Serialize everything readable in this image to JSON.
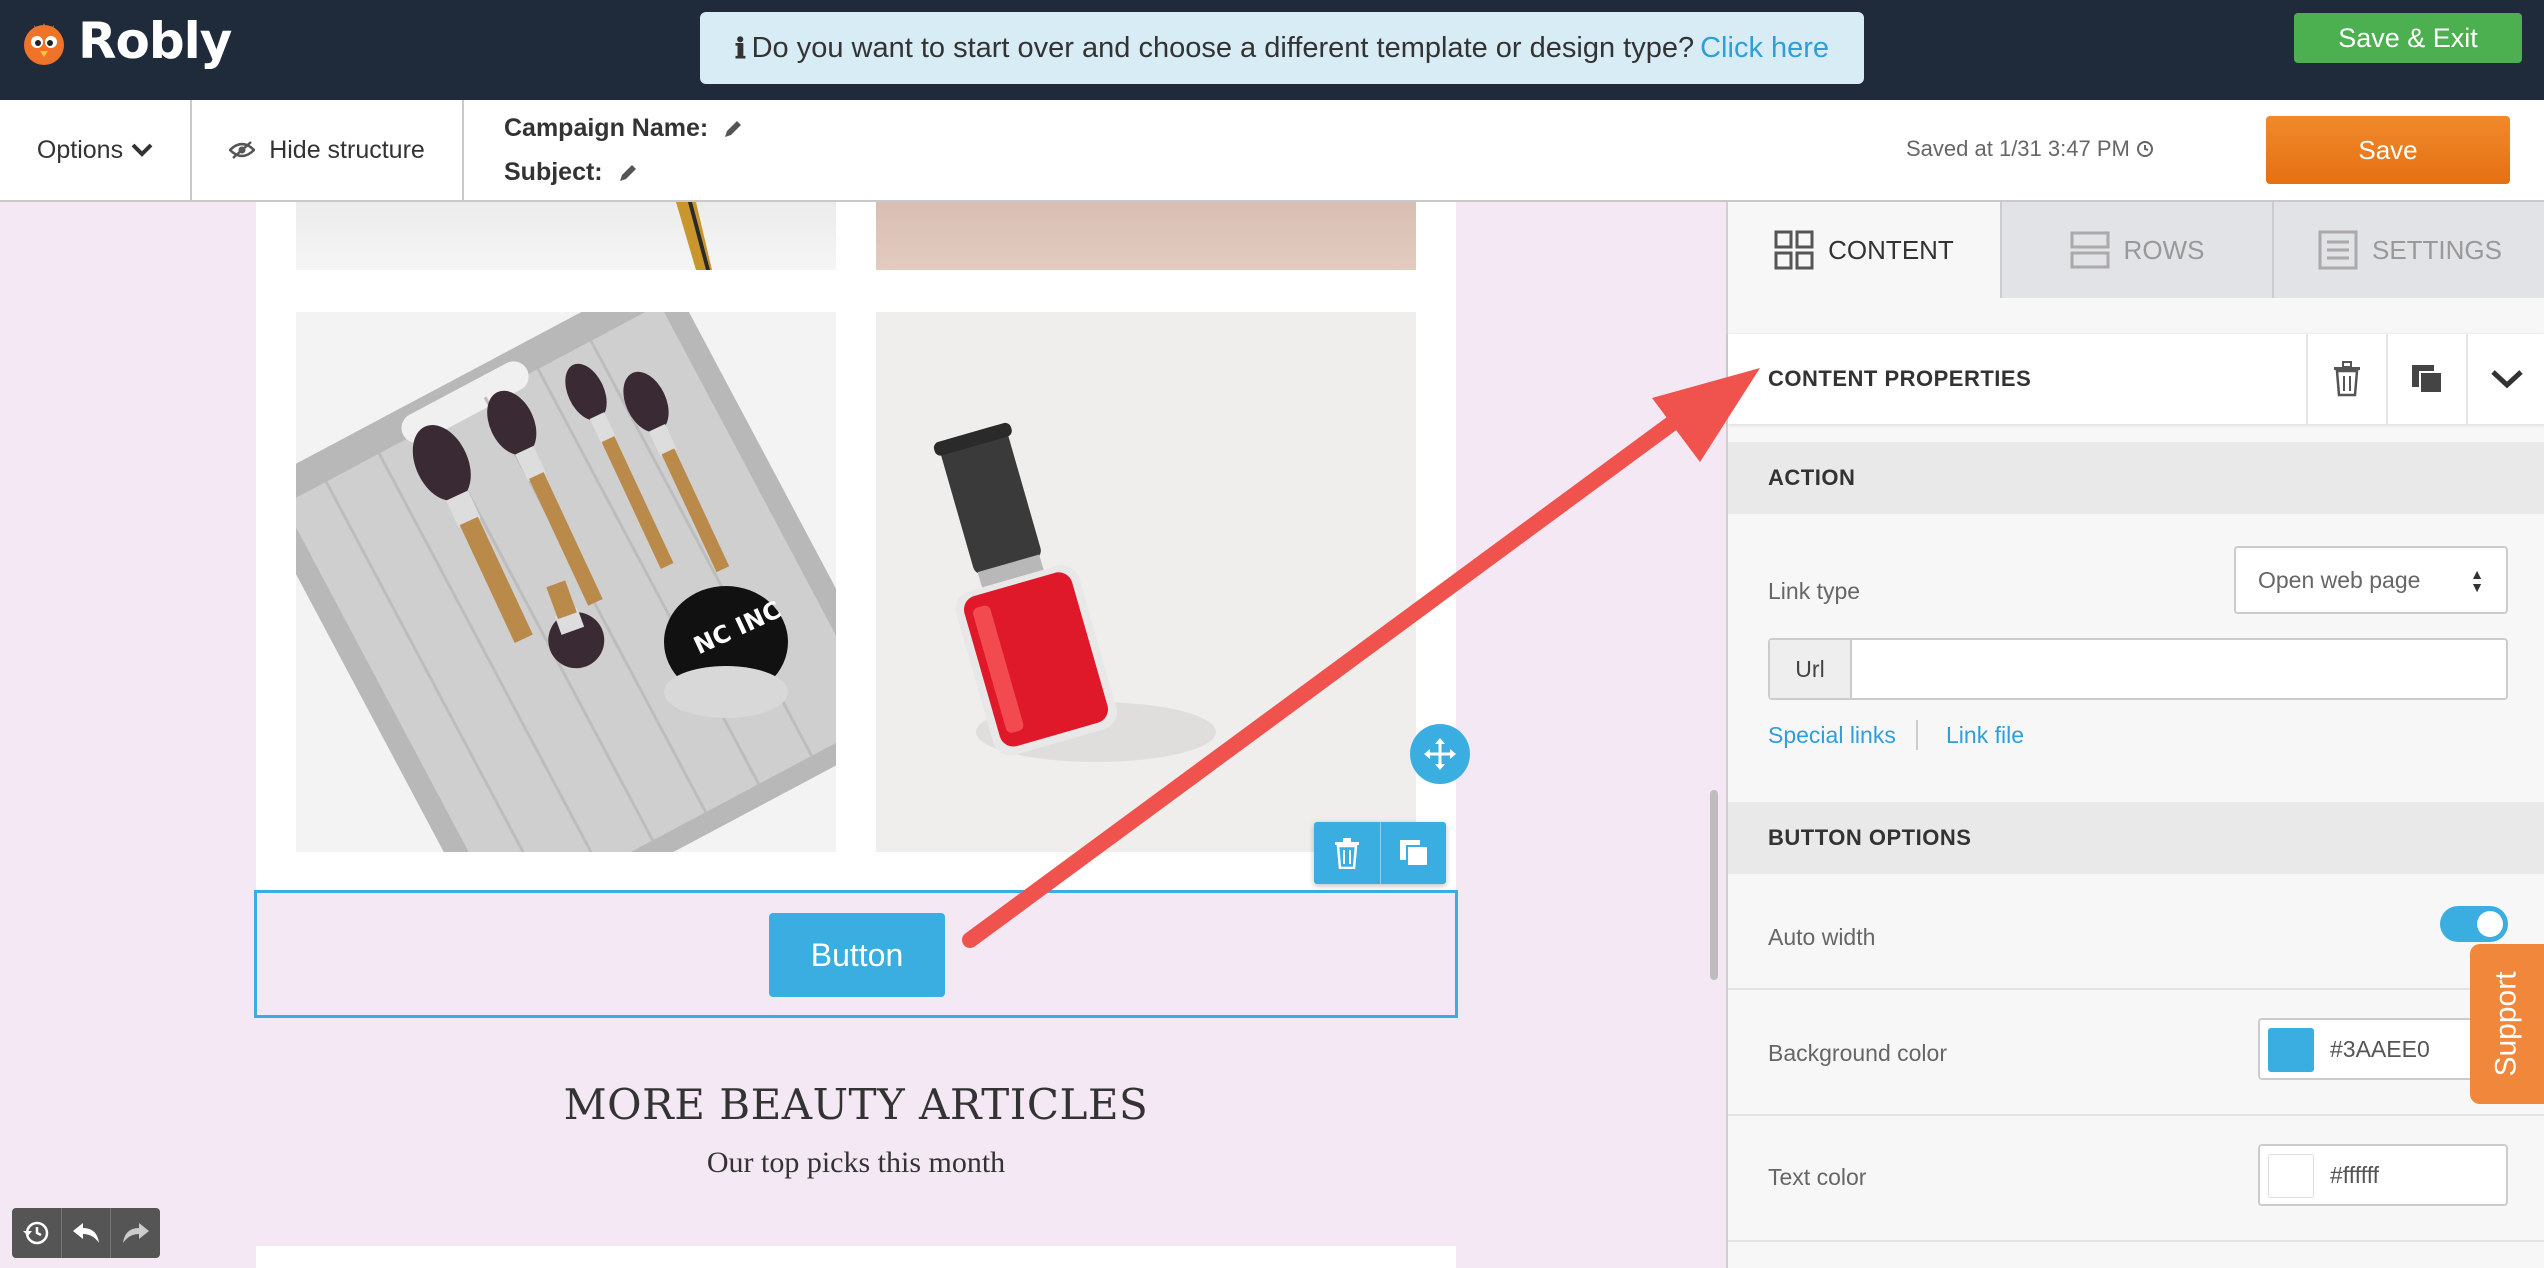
{
  "app": {
    "name": "Robly"
  },
  "notice": {
    "text": "Do you want to start over and choose a different template or design type?",
    "link": "Click here"
  },
  "topbar": {
    "save_exit": "Save & Exit"
  },
  "toolbar": {
    "options": "Options",
    "hide_structure": "Hide structure",
    "campaign_label": "Campaign Name:",
    "subject_label": "Subject:",
    "saved_text": "Saved at 1/31 3:47 PM",
    "save": "Save"
  },
  "email": {
    "button_label": "Button",
    "more_title": "MORE BEAUTY ARTICLES",
    "more_subtitle": "Our top picks this month",
    "polish_brand": "NC INC"
  },
  "panel": {
    "tabs": [
      {
        "label": "CONTENT",
        "icon": "grid-icon",
        "active": true
      },
      {
        "label": "ROWS",
        "icon": "rows-icon",
        "active": false
      },
      {
        "label": "SETTINGS",
        "icon": "settings-list-icon",
        "active": false
      }
    ],
    "props_title": "CONTENT PROPERTIES",
    "action_header": "ACTION",
    "link_type_label": "Link type",
    "link_type_value": "Open web page",
    "url_prefix": "Url",
    "url_value": "",
    "special_links": "Special links",
    "link_file": "Link file",
    "button_options_header": "BUTTON OPTIONS",
    "auto_width_label": "Auto width",
    "auto_width_on": true,
    "bg_color_label": "Background color",
    "bg_color_value": "#3AAEE0",
    "text_color_label": "Text color",
    "text_color_value": "#ffffff"
  },
  "support": {
    "label": "Support"
  },
  "colors": {
    "accent": "#3aaee0",
    "save_green": "#4caf50",
    "save_orange": "#e57012",
    "annotation_arrow": "#f0534d"
  }
}
